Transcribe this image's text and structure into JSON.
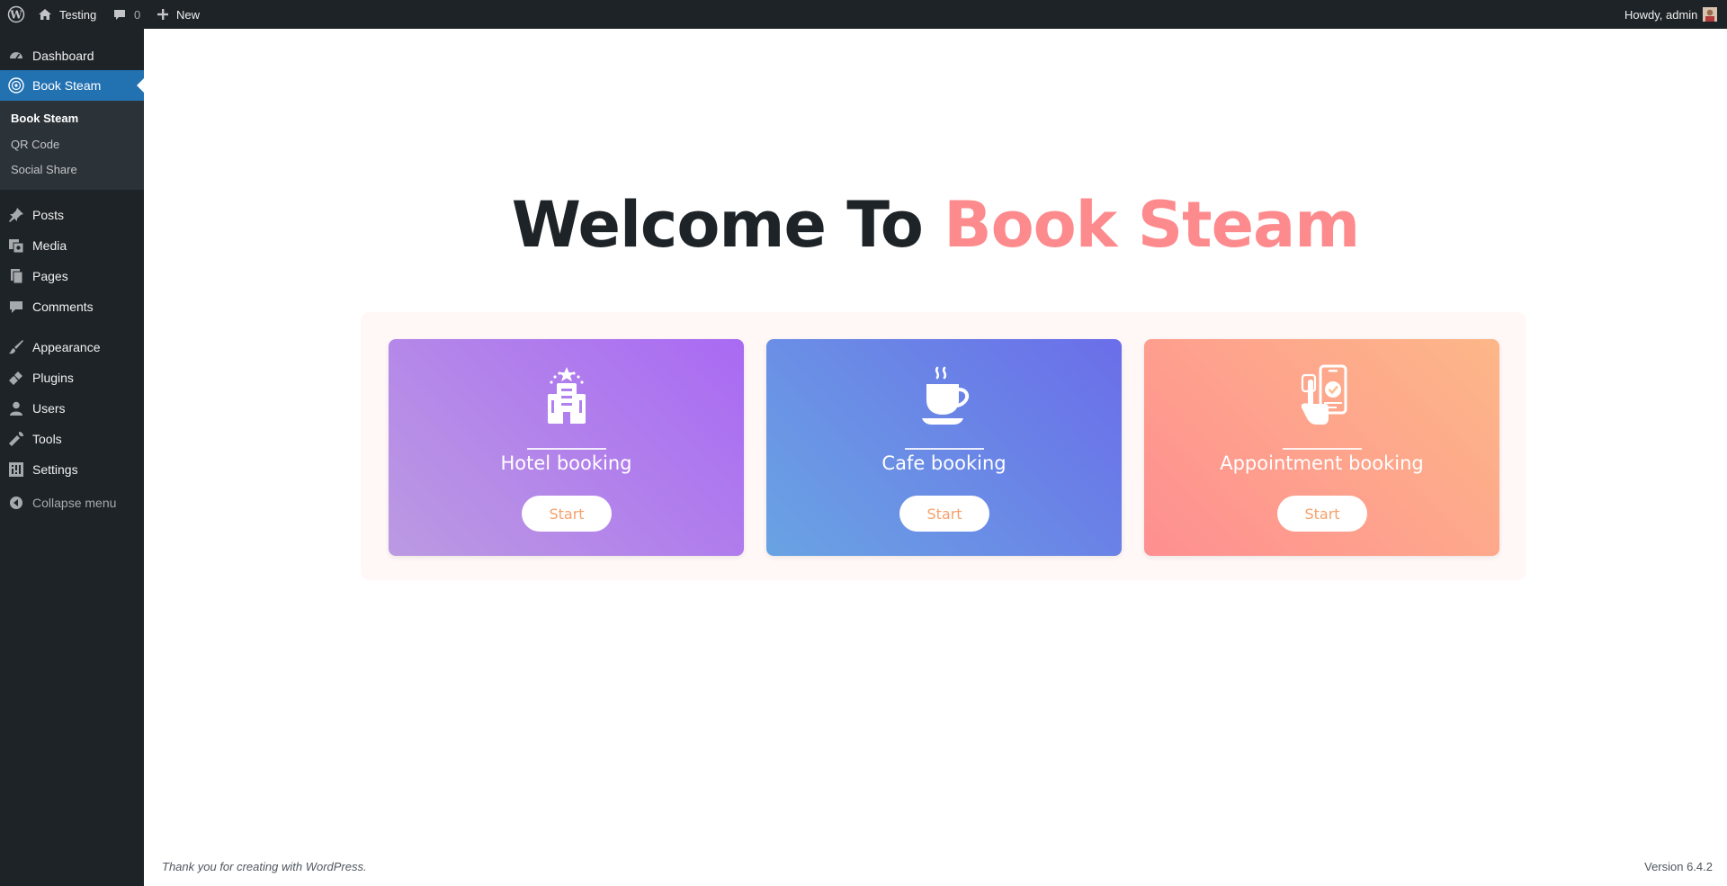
{
  "adminbar": {
    "site_name": "Testing",
    "comments_count": "0",
    "new_label": "New",
    "howdy": "Howdy, admin"
  },
  "sidebar": {
    "items": [
      {
        "label": "Dashboard",
        "icon": "dashboard-icon"
      },
      {
        "label": "Book Steam",
        "icon": "book-steam-icon"
      },
      {
        "label": "Posts",
        "icon": "pushpin-icon"
      },
      {
        "label": "Media",
        "icon": "media-icon"
      },
      {
        "label": "Pages",
        "icon": "pages-icon"
      },
      {
        "label": "Comments",
        "icon": "comment-icon"
      },
      {
        "label": "Appearance",
        "icon": "brush-icon"
      },
      {
        "label": "Plugins",
        "icon": "plugin-icon"
      },
      {
        "label": "Users",
        "icon": "user-icon"
      },
      {
        "label": "Tools",
        "icon": "wrench-icon"
      },
      {
        "label": "Settings",
        "icon": "settings-icon"
      }
    ],
    "submenu": [
      "Book Steam",
      "QR Code",
      "Social Share"
    ],
    "collapse_label": "Collapse menu"
  },
  "main": {
    "welcome_prefix": "Welcome To",
    "welcome_accent": "Book Steam",
    "cards": [
      {
        "title": "Hotel booking",
        "button": "Start",
        "icon": "hotel-icon"
      },
      {
        "title": "Cafe booking",
        "button": "Start",
        "icon": "coffee-cup-icon"
      },
      {
        "title": "Appointment booking",
        "button": "Start",
        "icon": "mobile-booking-icon"
      }
    ]
  },
  "footer": {
    "thanks": "Thank you for creating with WordPress.",
    "version": "Version 6.4.2"
  },
  "colors": {
    "admin_dark": "#1d2327",
    "highlight_blue": "#2271b1",
    "accent_coral": "#fd8a8c",
    "button_text": "#f6a06b"
  }
}
